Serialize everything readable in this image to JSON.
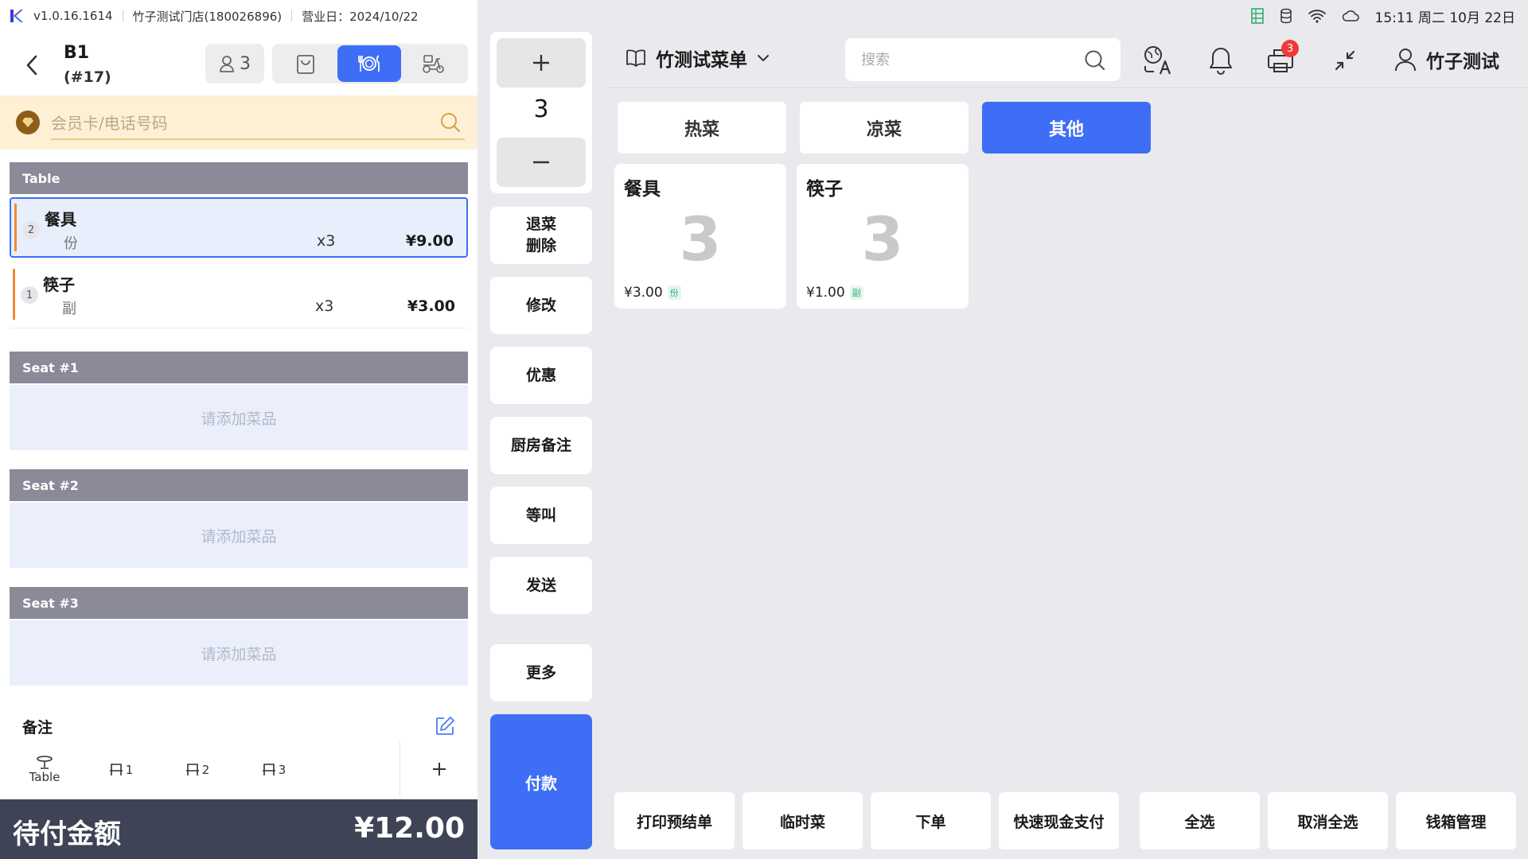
{
  "app": {
    "version": "v1.0.16.1614",
    "store": "竹子测试门店(180026896)",
    "business_day": "营业日：2024/10/22"
  },
  "order": {
    "table": "B1",
    "order_no": "(#17)",
    "guests": "3"
  },
  "member": {
    "placeholder": "会员卡/电话号码"
  },
  "sections": {
    "table_label": "Table",
    "items": [
      {
        "index": "2",
        "name": "餐具",
        "unit": "份",
        "qty": "x3",
        "price": "¥9.00",
        "selected": true
      },
      {
        "index": "1",
        "name": "筷子",
        "unit": "副",
        "qty": "x3",
        "price": "¥3.00",
        "selected": false
      }
    ],
    "seats": [
      {
        "label": "Seat #1",
        "empty_text": "请添加菜品"
      },
      {
        "label": "Seat #2",
        "empty_text": "请添加菜品"
      },
      {
        "label": "Seat #3",
        "empty_text": "请添加菜品"
      }
    ]
  },
  "remark": {
    "label": "备注"
  },
  "seat_tabs": [
    {
      "label": "Table"
    },
    {
      "label": "1"
    },
    {
      "label": "2"
    },
    {
      "label": "3"
    }
  ],
  "payment": {
    "label": "待付金额",
    "amount": "¥12.00"
  },
  "qty_panel": {
    "value": "3"
  },
  "actions": {
    "void_line1": "退菜",
    "void_line2": "删除",
    "modify": "修改",
    "discount": "优惠",
    "kitchen_note": "厨房备注",
    "hold": "等叫",
    "send": "发送",
    "more": "更多",
    "pay": "付款"
  },
  "status_bar": {
    "datetime": "15:11 周二 10月 22日"
  },
  "header": {
    "menu_name": "竹测试菜单",
    "search_placeholder": "搜索",
    "printer_badge": "3",
    "user_name": "竹子测试"
  },
  "categories": [
    {
      "label": "热菜",
      "active": false
    },
    {
      "label": "凉菜",
      "active": false
    },
    {
      "label": "其他",
      "active": true
    }
  ],
  "dishes": [
    {
      "name": "餐具",
      "count": "3",
      "price": "¥3.00",
      "unit": "份"
    },
    {
      "name": "筷子",
      "count": "3",
      "price": "¥1.00",
      "unit": "副"
    }
  ],
  "bottom_actions": [
    {
      "label": "打印预结单"
    },
    {
      "label": "临时菜"
    },
    {
      "label": "下单"
    },
    {
      "label": "快速现金支付"
    },
    {
      "label": "全选"
    },
    {
      "label": "取消全选"
    },
    {
      "label": "钱箱管理"
    }
  ],
  "colors": {
    "accent": "#3d6ef5",
    "header_gray": "#8a8a99",
    "pay_bar": "#3e4455",
    "member_bg": "#fdf0d4",
    "seat_empty_bg": "#ebeffc",
    "item_marker": "#ef8a3a",
    "badge_red": "#f03a3a"
  }
}
